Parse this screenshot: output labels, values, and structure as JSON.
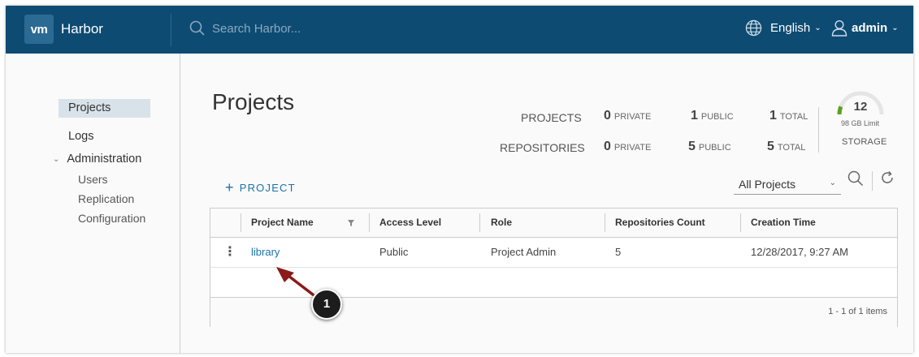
{
  "header": {
    "logo": "vm",
    "brand": "Harbor",
    "search_placeholder": "Search Harbor...",
    "language": "English",
    "user": "admin",
    "bg_color": "#0e4b73"
  },
  "sidebar": {
    "items": [
      {
        "label": "Projects",
        "active": true
      },
      {
        "label": "Logs"
      },
      {
        "label": "Administration",
        "expanded": true,
        "children": [
          {
            "label": "Users"
          },
          {
            "label": "Replication"
          },
          {
            "label": "Configuration"
          }
        ]
      }
    ]
  },
  "main": {
    "title": "Projects",
    "stats": {
      "projects_label": "PROJECTS",
      "repositories_label": "REPOSITORIES",
      "private_label": "PRIVATE",
      "public_label": "PUBLIC",
      "total_label": "TOTAL",
      "projects": {
        "private": "0",
        "public": "1",
        "total": "1"
      },
      "repositories": {
        "private": "0",
        "public": "5",
        "total": "5"
      }
    },
    "storage": {
      "value": "12",
      "limit": "98 GB Limit",
      "label": "STORAGE",
      "used_fraction": 0.12,
      "accent": "#5aa220"
    },
    "add_project": "PROJECT",
    "filter": {
      "selected": "All Projects"
    },
    "table": {
      "columns": [
        "Project Name",
        "Access Level",
        "Role",
        "Repositories Count",
        "Creation Time"
      ],
      "rows": [
        {
          "name": "library",
          "access": "Public",
          "role": "Project Admin",
          "repos": "5",
          "created": "12/28/2017, 9:27 AM"
        }
      ],
      "footer": "1 - 1 of 1 items"
    },
    "callout": {
      "number": "1",
      "color": "#8b1a1a"
    }
  }
}
